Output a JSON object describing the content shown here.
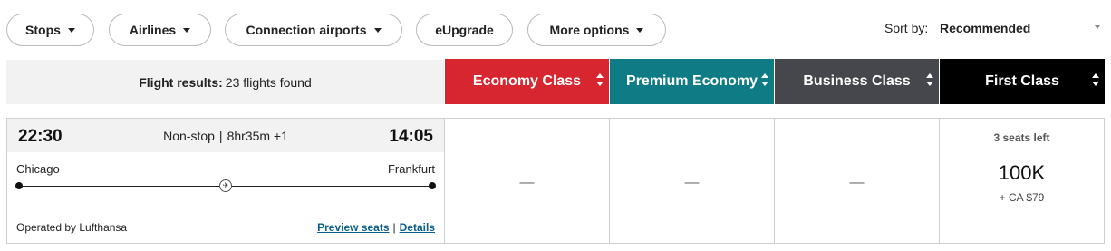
{
  "filters": [
    {
      "label": "Stops",
      "has_dropdown": true
    },
    {
      "label": "Airlines",
      "has_dropdown": true
    },
    {
      "label": "Connection airports",
      "has_dropdown": true
    },
    {
      "label": "eUpgrade",
      "has_dropdown": false
    },
    {
      "label": "More options",
      "has_dropdown": true
    }
  ],
  "sort": {
    "label": "Sort by:",
    "value": "Recommended"
  },
  "results": {
    "label": "Flight results:",
    "count_text": "23 flights found"
  },
  "classes": [
    {
      "label": "Economy Class",
      "color": "#d7262f"
    },
    {
      "label": "Premium Economy",
      "color": "#0f7b85"
    },
    {
      "label": "Business Class",
      "color": "#45474c"
    },
    {
      "label": "First Class",
      "color": "#000000"
    }
  ],
  "flight": {
    "departure_time": "22:30",
    "arrival_time": "14:05",
    "stops": "Non-stop",
    "duration": "8hr35m +1",
    "duration_separator": "|",
    "origin": "Chicago",
    "destination": "Frankfurt",
    "operated_by": "Operated by Lufthansa",
    "preview_seats_label": "Preview seats",
    "link_separator": "|",
    "details_label": "Details",
    "carrier_icon": "lufthansa-crane-icon",
    "fares": {
      "economy": "—",
      "premium_economy": "—",
      "business": "—",
      "first": {
        "seats_left": "3 seats left",
        "miles": "100K",
        "tax": "+ CA $79"
      }
    }
  }
}
